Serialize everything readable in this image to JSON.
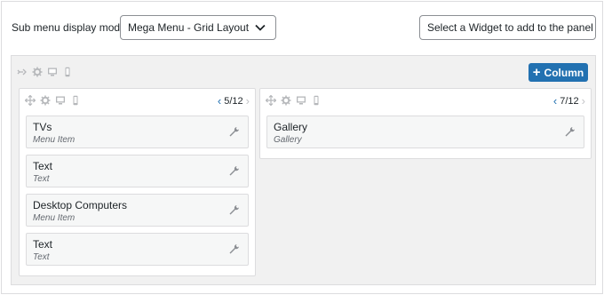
{
  "submenu": {
    "label": "Sub menu display mode",
    "mode_value": "Mega Menu - Grid Layout",
    "widget_placeholder": "Select a Widget to add to the panel"
  },
  "panel": {
    "add_column_label": "Column",
    "columns": [
      {
        "span": "5/12",
        "items": [
          {
            "title": "TVs",
            "type": "Menu Item"
          },
          {
            "title": "Text",
            "type": "Text"
          },
          {
            "title": "Desktop Computers",
            "type": "Menu Item"
          },
          {
            "title": "Text",
            "type": "Text"
          }
        ]
      },
      {
        "span": "7/12",
        "items": [
          {
            "title": "Gallery",
            "type": "Gallery"
          }
        ]
      }
    ]
  },
  "colors": {
    "accent": "#2271b1",
    "panel_bg": "#f1f1f1",
    "item_bg": "#f6f7f7",
    "icon_gray": "#b5b7ba"
  },
  "icons": [
    "move-icon",
    "gear-icon",
    "desktop-icon",
    "mobile-icon",
    "wrench-icon",
    "chevron-down-icon",
    "chevron-left-icon",
    "chevron-right-icon",
    "plus-icon"
  ]
}
